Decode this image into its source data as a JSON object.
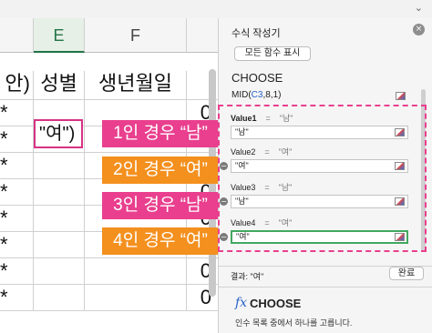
{
  "spreadsheet": {
    "columns": [
      "E",
      "F"
    ],
    "selected_column": "E",
    "header_row": {
      "left_fragment": "안)",
      "gender": "성별",
      "birthdate": "생년월일"
    },
    "rows": [
      {
        "left": "*",
        "gender": "\"여\")",
        "right": "0"
      },
      {
        "left": "*",
        "gender": "",
        "right": "0"
      },
      {
        "left": "*",
        "gender": "",
        "right": "0"
      },
      {
        "left": "*",
        "gender": "",
        "right": "0"
      },
      {
        "left": "*",
        "gender": "",
        "right": "0"
      },
      {
        "left": "*",
        "gender": "",
        "right": "0"
      },
      {
        "left": "*",
        "gender": "",
        "right": "0"
      },
      {
        "left": "*",
        "gender": "",
        "right": "0"
      }
    ]
  },
  "callouts": [
    {
      "text": "1인 경우 “남”",
      "color": "#e93f8e"
    },
    {
      "text": "2인 경우 “여”",
      "color": "#f4901e"
    },
    {
      "text": "3인 경우 “남”",
      "color": "#e93f8e"
    },
    {
      "text": "4인 경우 “여”",
      "color": "#f4901e"
    }
  ],
  "formula_builder": {
    "title": "수식 작성기",
    "close_icon": "close-icon",
    "show_all_button": "모든 함수 표시",
    "function_name": "CHOOSE",
    "expression": {
      "prefix": "MID(",
      "ref": "C3",
      "suffix": ",8,1)"
    },
    "args": [
      {
        "label": "Value1",
        "preview": "\"남\"",
        "value": "\"남\""
      },
      {
        "label": "Value2",
        "preview": "\"여\"",
        "value": "\"여\""
      },
      {
        "label": "Value3",
        "preview": "\"남\"",
        "value": "\"남\""
      },
      {
        "label": "Value4",
        "preview": "\"여\"",
        "value": "\"여\""
      }
    ],
    "equals": "=",
    "result_label": "결과: \"여\"",
    "done_button": "완료",
    "fx_symbol": "fx",
    "fx_function": "CHOOSE",
    "description": "인수 목록 중에서 하나를 고릅니다."
  },
  "colors": {
    "pink": "#e93f8e",
    "orange": "#f4901e",
    "accent_blue": "#2a62c9",
    "active_green": "#42a85f"
  }
}
